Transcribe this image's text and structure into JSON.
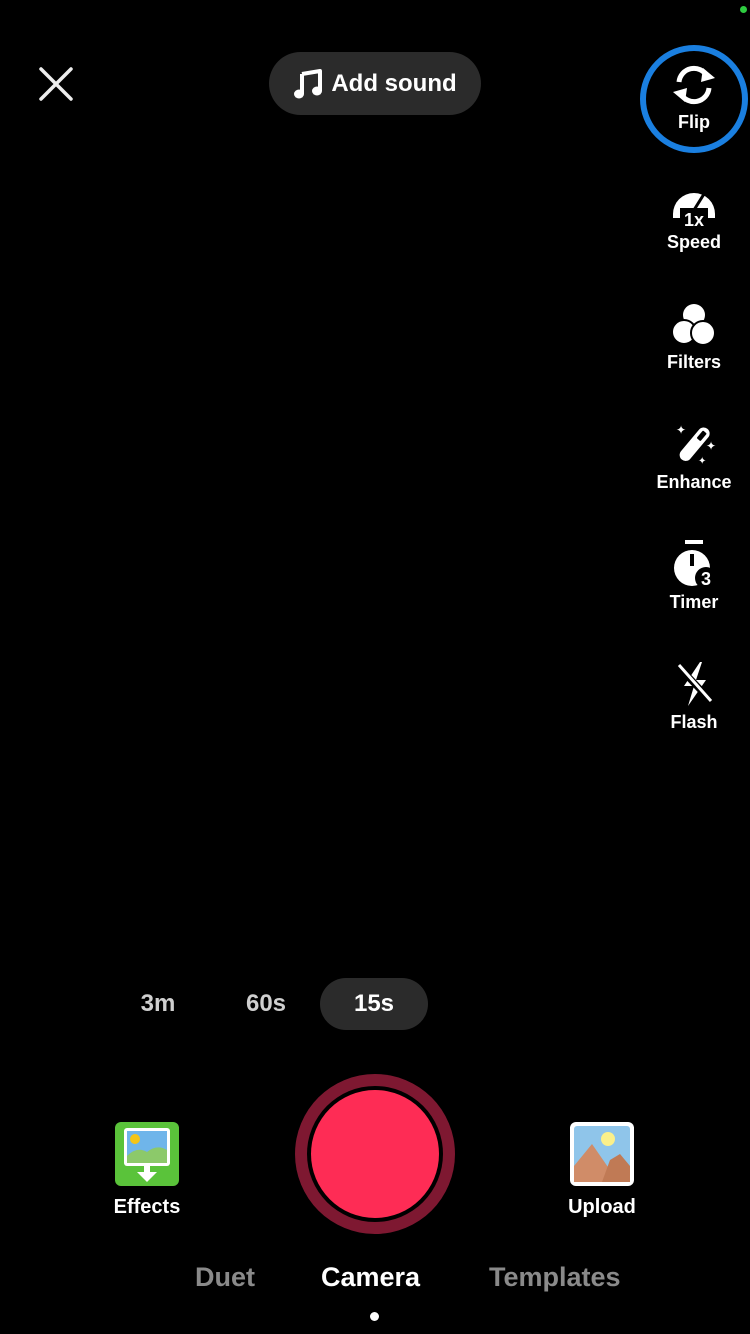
{
  "status": {
    "indicator_color": "#2ecc40"
  },
  "top_bar": {
    "close_icon": "close-icon",
    "add_sound": {
      "icon": "music-note-icon",
      "label": "Add sound"
    }
  },
  "side_tools": {
    "flip": {
      "label": "Flip",
      "icon": "flip-camera-icon",
      "highlight_color": "#1a7fe0"
    },
    "speed": {
      "label": "Speed",
      "icon": "speed-gauge-icon",
      "badge": "1x"
    },
    "filters": {
      "label": "Filters",
      "icon": "filters-icon"
    },
    "enhance": {
      "label": "Enhance",
      "icon": "magic-wand-icon"
    },
    "timer": {
      "label": "Timer",
      "icon": "timer-icon",
      "badge": "3"
    },
    "flash": {
      "label": "Flash",
      "icon": "flash-off-icon"
    }
  },
  "durations": {
    "options": [
      "3m",
      "60s",
      "15s"
    ],
    "selected": "15s"
  },
  "bottom": {
    "effects": {
      "label": "Effects",
      "icon": "effects-icon",
      "color": "#5ac33a"
    },
    "record": {
      "icon": "record-button",
      "color": "#fe2c55",
      "ring_color": "#7e1831"
    },
    "upload": {
      "label": "Upload",
      "icon": "gallery-icon"
    }
  },
  "modes": {
    "tabs": [
      "Duet",
      "Camera",
      "Templates"
    ],
    "selected": "Camera"
  }
}
